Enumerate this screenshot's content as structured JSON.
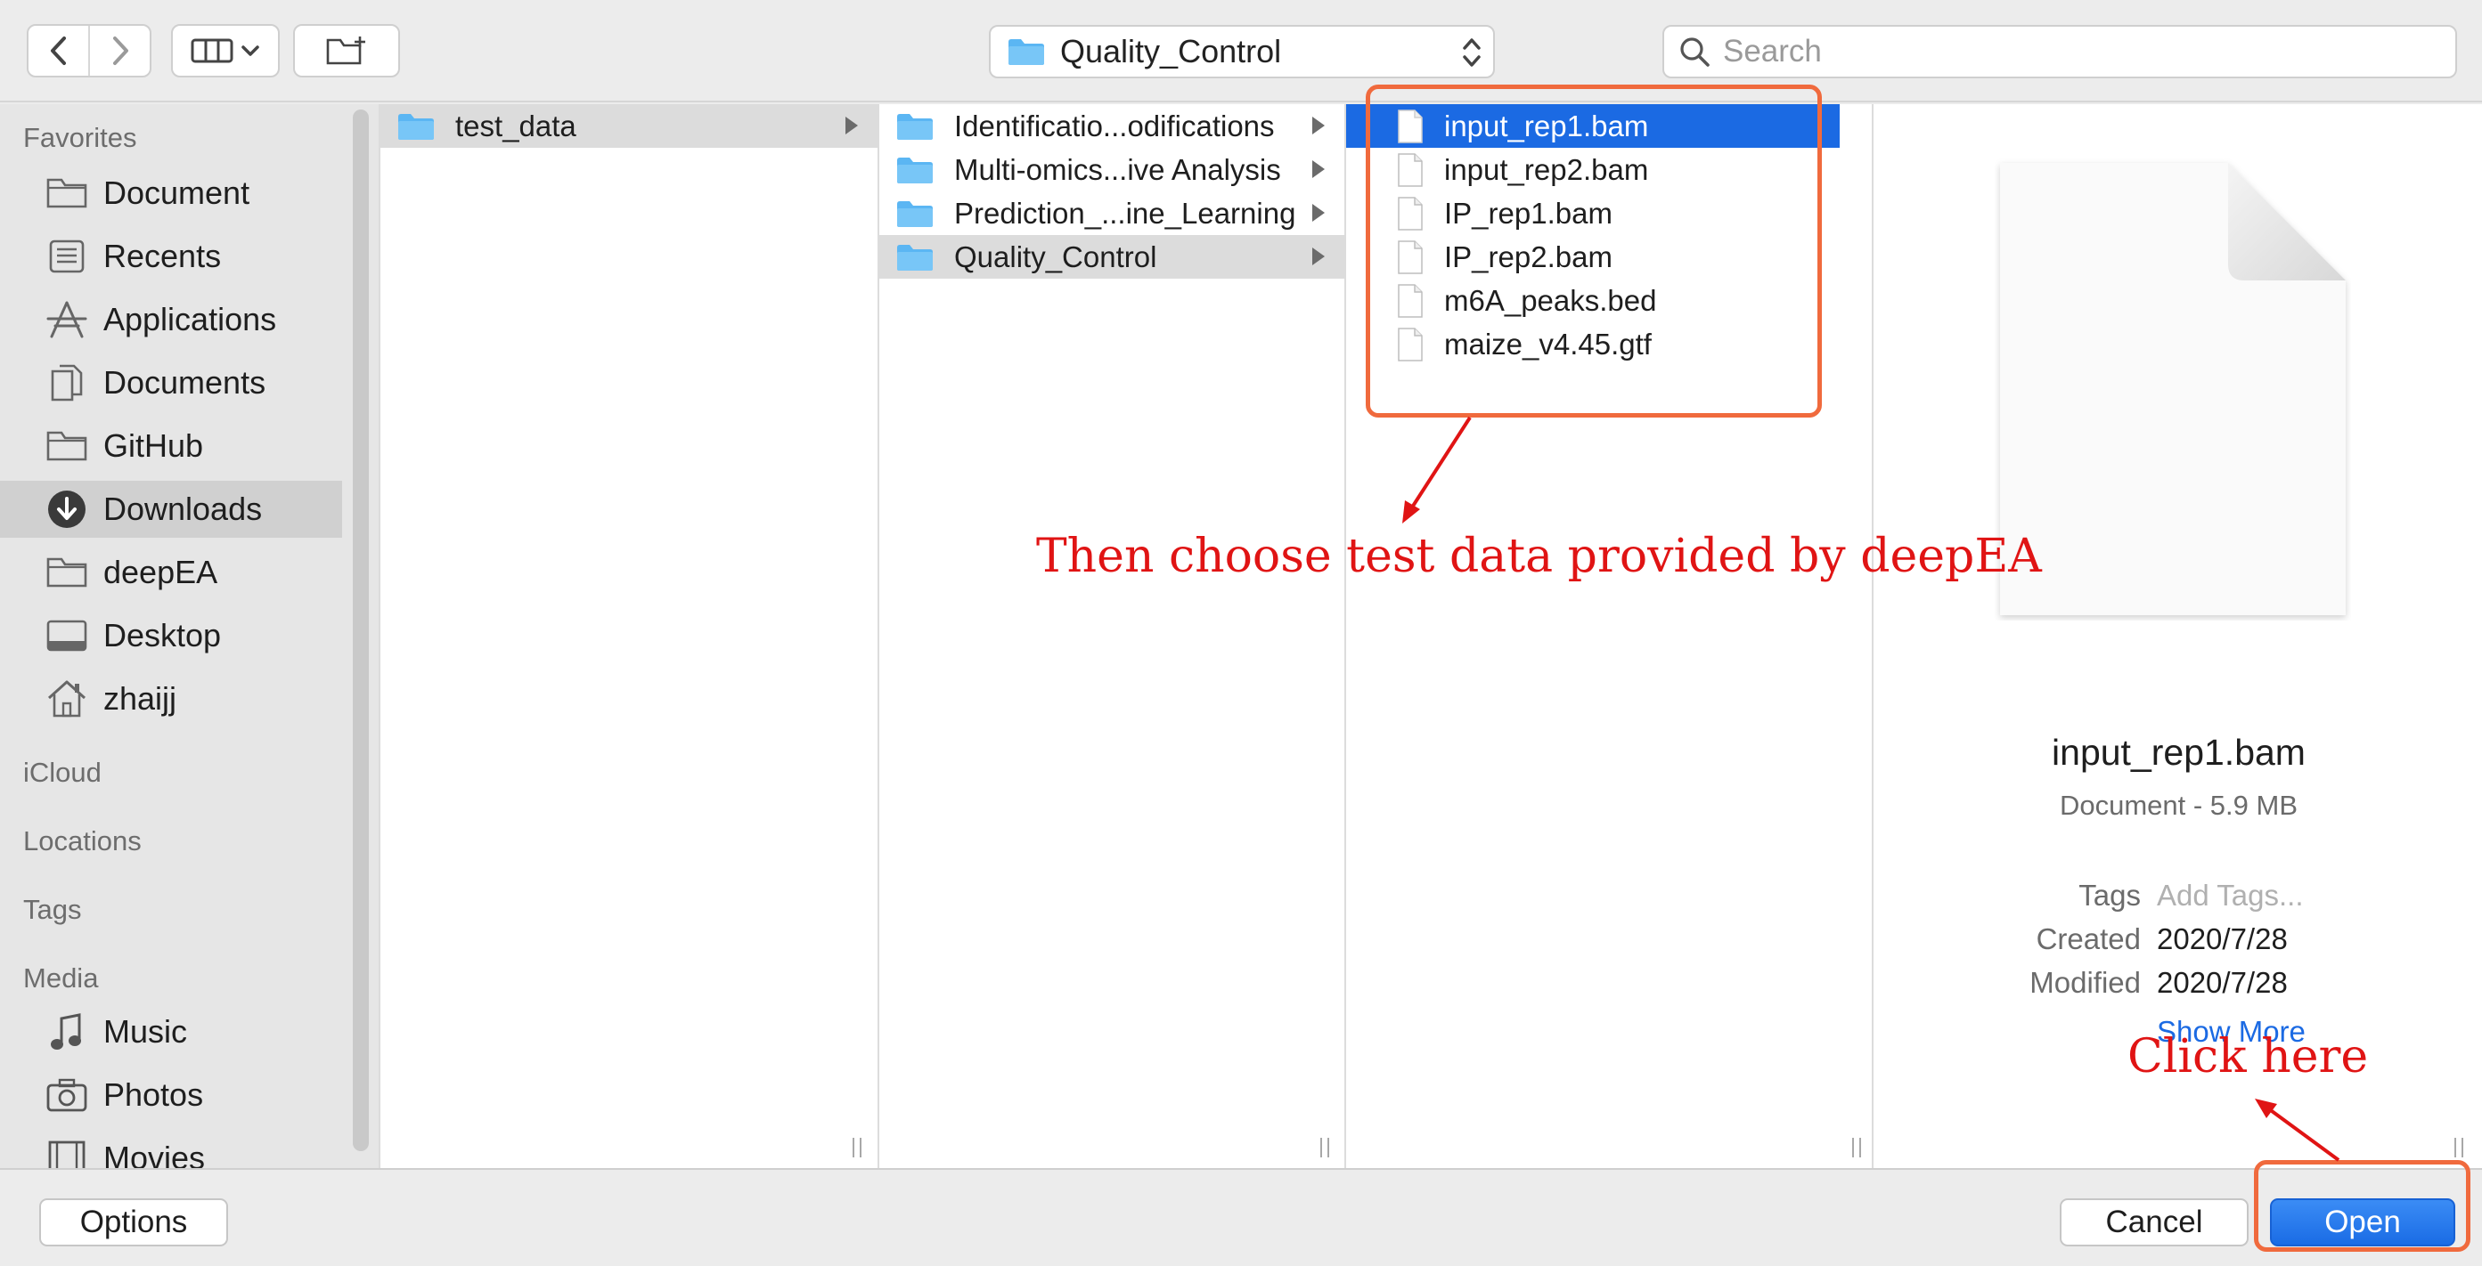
{
  "toolbar": {
    "path_popup": "Quality_Control",
    "search_placeholder": "Search"
  },
  "sidebar": {
    "sections": {
      "favorites": "Favorites",
      "icloud": "iCloud",
      "locations": "Locations",
      "tags": "Tags",
      "media": "Media"
    },
    "favorites": [
      {
        "label": "Document",
        "icon": "folder-icon"
      },
      {
        "label": "Recents",
        "icon": "recents-icon"
      },
      {
        "label": "Applications",
        "icon": "applications-icon"
      },
      {
        "label": "Documents",
        "icon": "documents-icon"
      },
      {
        "label": "GitHub",
        "icon": "folder-icon"
      },
      {
        "label": "Downloads",
        "icon": "downloads-icon",
        "selected": true
      },
      {
        "label": "deepEA",
        "icon": "folder-icon"
      },
      {
        "label": "Desktop",
        "icon": "desktop-icon"
      },
      {
        "label": "zhaijj",
        "icon": "home-icon"
      }
    ],
    "media": [
      {
        "label": "Music",
        "icon": "music-icon"
      },
      {
        "label": "Photos",
        "icon": "camera-icon"
      },
      {
        "label": "Movies",
        "icon": "film-icon"
      }
    ]
  },
  "columns": {
    "col1": [
      {
        "name": "test_data",
        "selected": true
      }
    ],
    "col2": [
      {
        "name": "Identificatio...odifications"
      },
      {
        "name": "Multi-omics...ive Analysis"
      },
      {
        "name": "Prediction_...ine_Learning"
      },
      {
        "name": "Quality_Control",
        "selected": true
      }
    ],
    "col3": [
      {
        "name": "input_rep1.bam",
        "selected": true
      },
      {
        "name": "input_rep2.bam"
      },
      {
        "name": "IP_rep1.bam"
      },
      {
        "name": "IP_rep2.bam"
      },
      {
        "name": "m6A_peaks.bed"
      },
      {
        "name": "maize_v4.45.gtf"
      }
    ]
  },
  "preview": {
    "file_name": "input_rep1.bam",
    "kind_size": "Document - 5.9 MB",
    "tags_label": "Tags",
    "tags_value": "Add Tags...",
    "created_label": "Created",
    "created_value": "2020/7/28",
    "modified_label": "Modified",
    "modified_value": "2020/7/28",
    "show_more": "Show More"
  },
  "buttons": {
    "options": "Options",
    "cancel": "Cancel",
    "open": "Open"
  },
  "annotations": {
    "choose_text": "Then choose test data provided by deepEA",
    "click_text": "Click here",
    "color": "#e01414",
    "highlight_color": "#f06a3d"
  },
  "colors": {
    "selection_blue": "#1b6ae3",
    "folder_blue": "#5bb6f3"
  }
}
